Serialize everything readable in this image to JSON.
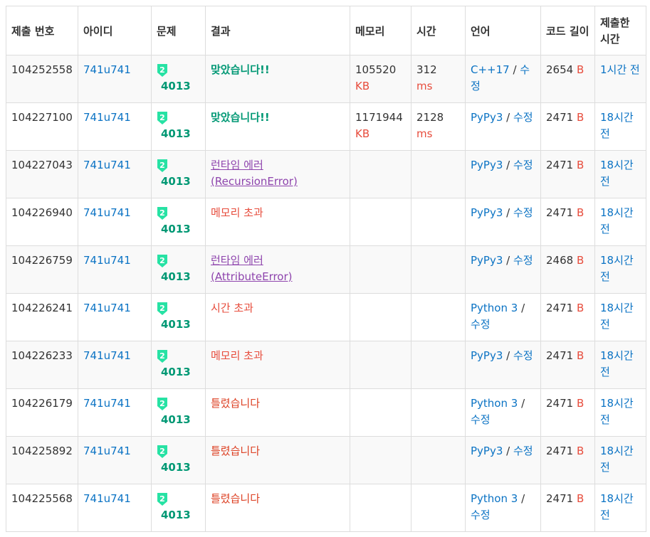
{
  "headers": [
    "제출 번호",
    "아이디",
    "문제",
    "결과",
    "메모리",
    "시간",
    "언어",
    "코드 길이",
    "제출한 시간"
  ],
  "tier_label": "2",
  "edit_label": "수정",
  "memory_unit": "KB",
  "time_unit": "ms",
  "length_unit": "B",
  "rows": [
    {
      "id": "104252558",
      "user": "741u741",
      "problem": "4013",
      "result": "맞았습니다!!",
      "result_type": "ac",
      "memory": "105520",
      "time": "312",
      "lang": "C++17",
      "length": "2654",
      "submitted": "1시간 전"
    },
    {
      "id": "104227100",
      "user": "741u741",
      "problem": "4013",
      "result": "맞았습니다!!",
      "result_type": "ac",
      "memory": "1171944",
      "time": "2128",
      "lang": "PyPy3",
      "length": "2471",
      "submitted": "18시간 전"
    },
    {
      "id": "104227043",
      "user": "741u741",
      "problem": "4013",
      "result": "런타임 에러 (RecursionError)",
      "result_type": "rte",
      "memory": "",
      "time": "",
      "lang": "PyPy3",
      "length": "2471",
      "submitted": "18시간 전"
    },
    {
      "id": "104226940",
      "user": "741u741",
      "problem": "4013",
      "result": "메모리 초과",
      "result_type": "mle",
      "memory": "",
      "time": "",
      "lang": "PyPy3",
      "length": "2471",
      "submitted": "18시간 전"
    },
    {
      "id": "104226759",
      "user": "741u741",
      "problem": "4013",
      "result": "런타임 에러 (AttributeError)",
      "result_type": "rte",
      "memory": "",
      "time": "",
      "lang": "PyPy3",
      "length": "2468",
      "submitted": "18시간 전"
    },
    {
      "id": "104226241",
      "user": "741u741",
      "problem": "4013",
      "result": "시간 초과",
      "result_type": "tle",
      "memory": "",
      "time": "",
      "lang": "Python 3",
      "length": "2471",
      "submitted": "18시간 전"
    },
    {
      "id": "104226233",
      "user": "741u741",
      "problem": "4013",
      "result": "메모리 초과",
      "result_type": "mle",
      "memory": "",
      "time": "",
      "lang": "PyPy3",
      "length": "2471",
      "submitted": "18시간 전"
    },
    {
      "id": "104226179",
      "user": "741u741",
      "problem": "4013",
      "result": "틀렸습니다",
      "result_type": "wa",
      "memory": "",
      "time": "",
      "lang": "Python 3",
      "length": "2471",
      "submitted": "18시간 전"
    },
    {
      "id": "104225892",
      "user": "741u741",
      "problem": "4013",
      "result": "틀렸습니다",
      "result_type": "wa",
      "memory": "",
      "time": "",
      "lang": "PyPy3",
      "length": "2471",
      "submitted": "18시간 전"
    },
    {
      "id": "104225568",
      "user": "741u741",
      "problem": "4013",
      "result": "틀렸습니다",
      "result_type": "wa",
      "memory": "",
      "time": "",
      "lang": "Python 3",
      "length": "2471",
      "submitted": "18시간 전"
    }
  ],
  "colors": {
    "link": "#0b73c4",
    "accepted": "#009874",
    "error": "#e74c3c",
    "runtime": "#8e44ad",
    "wrong": "#dd4124",
    "tier": "#27e2a4"
  }
}
